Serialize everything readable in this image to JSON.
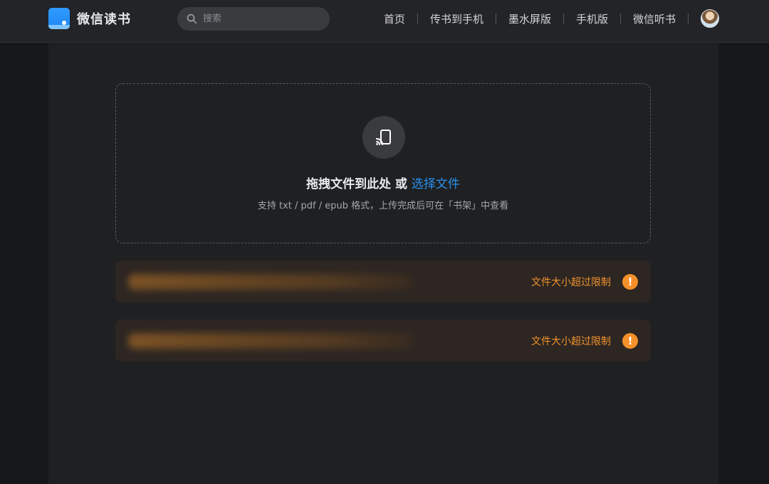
{
  "header": {
    "logo_text": "微信读书",
    "search_placeholder": "搜索",
    "nav": [
      "首页",
      "传书到手机",
      "墨水屏版",
      "手机版",
      "微信听书"
    ]
  },
  "upload": {
    "title_main": "拖拽文件到此处 或 ",
    "title_link": "选择文件",
    "subtitle": "支持 txt / pdf / epub 格式，上传完成后可在「书架」中查看"
  },
  "files": [
    {
      "name": "",
      "status": "文件大小超过限制"
    },
    {
      "name": "",
      "status": "文件大小超过限制"
    }
  ],
  "colors": {
    "accent": "#2a91ef",
    "warning": "#f0922d",
    "background": "#1f2022"
  },
  "icons": [
    "search-icon",
    "cast-icon",
    "warning-icon"
  ]
}
